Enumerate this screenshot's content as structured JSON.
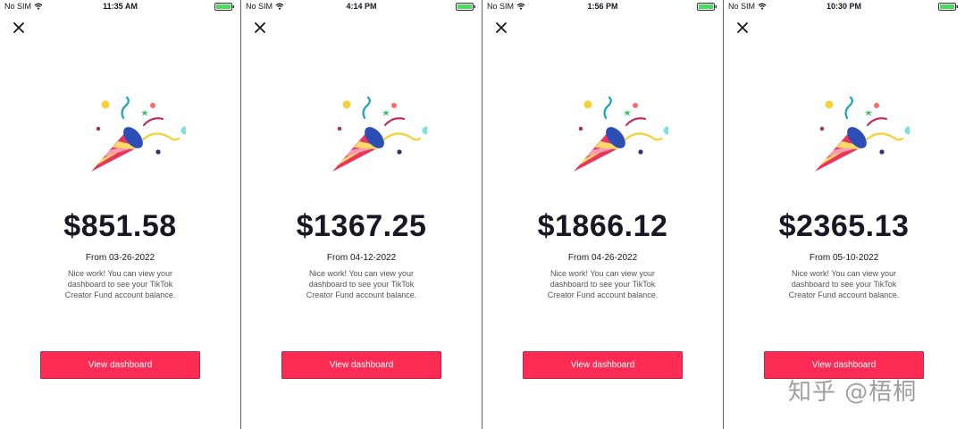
{
  "colors": {
    "accent": "#fe2c55",
    "text": "#161823",
    "muted": "#555555",
    "battery": "#4cd964"
  },
  "panels": [
    {
      "carrier": "No SIM",
      "time": "11:35 AM",
      "amount": "$851.58",
      "from_label": "From",
      "date": "03-26-2022",
      "message": "Nice work! You can view your dashboard to see your TikTok Creator Fund account balance.",
      "button": "View dashboard"
    },
    {
      "carrier": "No SIM",
      "time": "4:14 PM",
      "amount": "$1367.25",
      "from_label": "From",
      "date": "04-12-2022",
      "message": "Nice work! You can view your dashboard to see your TikTok Creator Fund account balance.",
      "button": "View dashboard"
    },
    {
      "carrier": "No SIM",
      "time": "1:56 PM",
      "amount": "$1866.12",
      "from_label": "From",
      "date": "04-26-2022",
      "message": "Nice work! You can view your dashboard to see your TikTok Creator Fund account balance.",
      "button": "View dashboard"
    },
    {
      "carrier": "No SIM",
      "time": "10:30 PM",
      "amount": "$2365.13",
      "from_label": "From",
      "date": "05-10-2022",
      "message": "Nice work! You can view your dashboard to see your TikTok Creator Fund account balance.",
      "button": "View dashboard"
    }
  ],
  "icons": {
    "close": "close-icon",
    "wifi": "wifi-icon",
    "battery": "battery-icon",
    "illustration": "party-popper-icon"
  },
  "watermark": "知乎 @梧桐"
}
